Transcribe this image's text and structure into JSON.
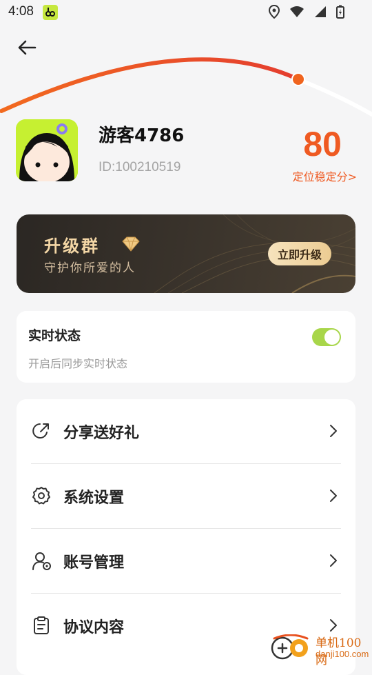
{
  "status_bar": {
    "time": "4:08",
    "icons": [
      "app-notification-icon",
      "location-icon",
      "wifi-icon",
      "signal-icon",
      "battery-charging-icon"
    ]
  },
  "header": {
    "back_icon": "arrow-left-icon",
    "arc_gradient": [
      "#f0641e",
      "#e8402e"
    ],
    "arc_marker_color": "#f0641e"
  },
  "profile": {
    "username": "游客4786",
    "user_id": "ID:100210519",
    "score": "80",
    "score_link": "定位稳定分>"
  },
  "banner": {
    "title": "升级群",
    "subtitle": "守护你所爱的人",
    "button": "立即升级",
    "gem_icon": "diamond-icon"
  },
  "realtime": {
    "title": "实时状态",
    "subtitle": "开启后同步实时状态",
    "toggle_on": true,
    "toggle_color": "#a8d64a"
  },
  "menu": {
    "items": [
      {
        "label": "分享送好礼",
        "icon": "share-icon"
      },
      {
        "label": "系统设置",
        "icon": "gear-icon"
      },
      {
        "label": "账号管理",
        "icon": "user-settings-icon"
      },
      {
        "label": "协议内容",
        "icon": "clipboard-icon"
      }
    ]
  },
  "watermark": {
    "title": "单机100网",
    "url": "danji100.com"
  },
  "colors": {
    "accent": "#ef5a22",
    "background": "#f5f5f6",
    "banner_bg": "#2b2723",
    "banner_gold": "#f4d7a6"
  }
}
